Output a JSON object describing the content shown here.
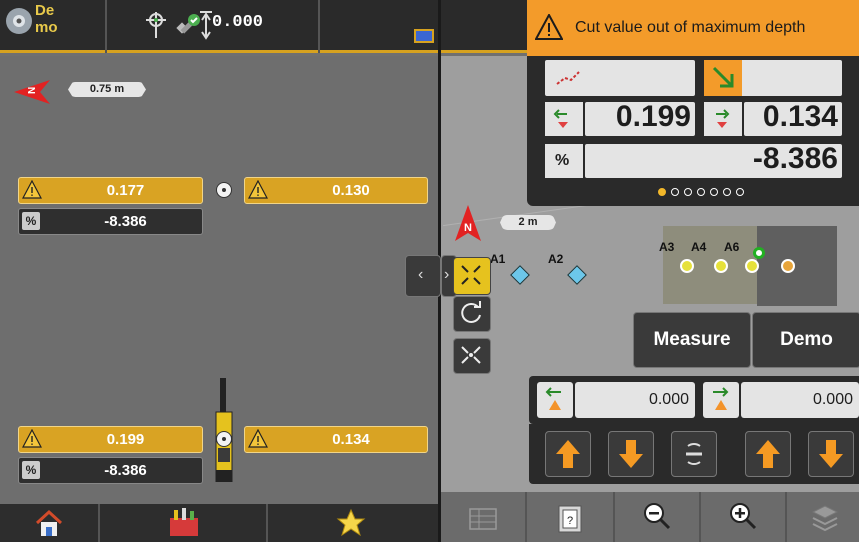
{
  "topbar": {
    "mode_line1": "De",
    "mode_line2": "mo",
    "depth_value": "0.000"
  },
  "banner": {
    "message": "Cut value out of maximum depth"
  },
  "left_panel": {
    "scale_label": "0.75 m",
    "top_left_value": "0.177",
    "top_right_value": "0.130",
    "top_percent": "-8.386",
    "bottom_left_value": "0.199",
    "bottom_right_value": "0.134",
    "bottom_percent": "-8.386"
  },
  "readings": {
    "left_value": "0.199",
    "right_value": "0.134",
    "percent_label": "%",
    "percent_value": "-8.386",
    "page_index": 1,
    "page_count": 6
  },
  "map": {
    "north_label": "N",
    "scale_label": "2 m",
    "points": [
      "A1",
      "A2",
      "A3",
      "A4",
      "A6"
    ]
  },
  "buttons": {
    "measure": "Measure",
    "demo": "Demo"
  },
  "offsets": {
    "left_value": "0.000",
    "right_value": "0.000"
  },
  "colors": {
    "accent_yellow": "#d9a323",
    "banner_orange": "#f39b2a",
    "dark_panel": "#2a2a2a"
  }
}
